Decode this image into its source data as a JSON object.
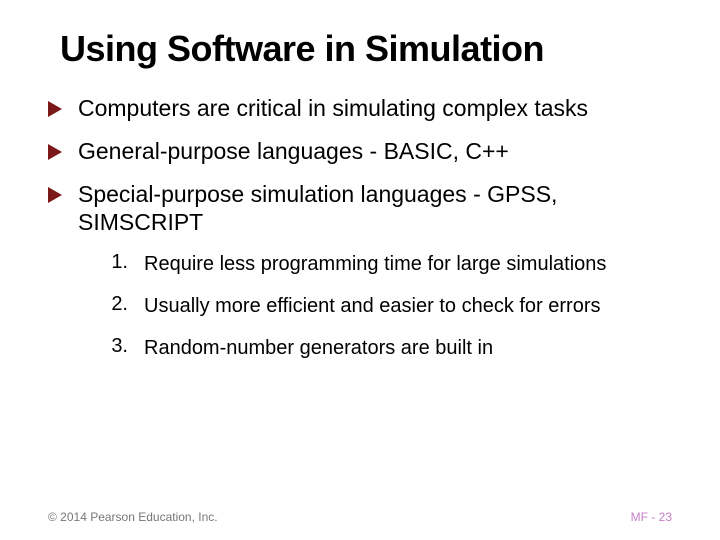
{
  "title": "Using Software in Simulation",
  "bullets": [
    "Computers are critical in simulating complex tasks",
    "General-purpose languages - BASIC, C++",
    "Special-purpose simulation languages - GPSS, SIMSCRIPT"
  ],
  "numbered": [
    {
      "num": "1.",
      "text": "Require less programming time for large simulations"
    },
    {
      "num": "2.",
      "text": "Usually more efficient and easier to check for errors"
    },
    {
      "num": "3.",
      "text": "Random-number generators are built in"
    }
  ],
  "footer": {
    "copyright": "© 2014 Pearson Education, Inc.",
    "page": "MF - 23"
  },
  "colors": {
    "bullet": "#7a1818"
  }
}
